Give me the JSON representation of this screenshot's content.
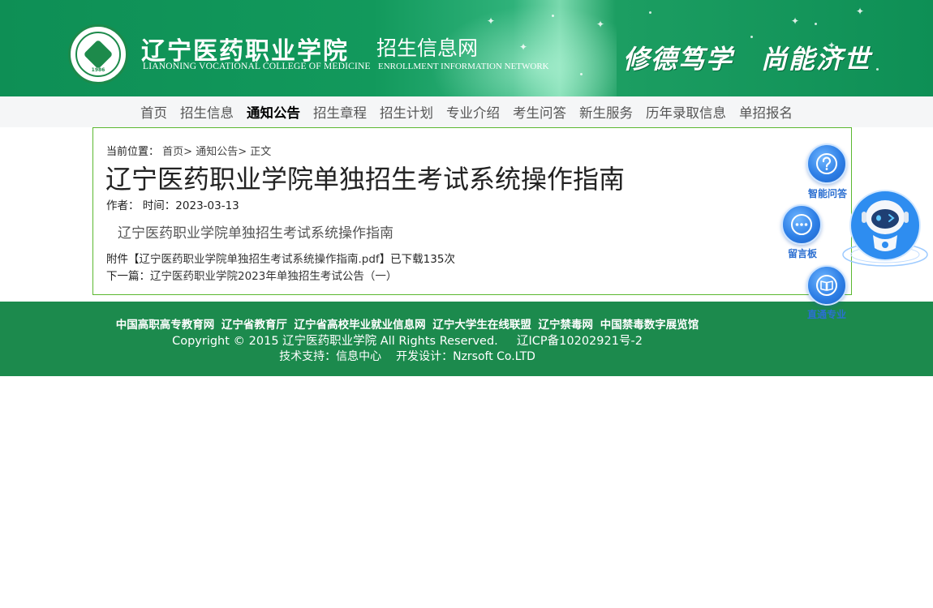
{
  "header": {
    "school_name_cn": "辽宁医药职业学院",
    "school_name_en": "LIANONING VOCATIONAL COLLEGE OF MEDICINE",
    "site_name_cn": "招生信息网",
    "site_name_en": "ENROLLMENT INFORMATION NETWORK",
    "motto": "修德笃学　尚能济世",
    "seal_year": "1986",
    "seal_icon": "college-seal-icon"
  },
  "nav": {
    "items": [
      {
        "label": "首页"
      },
      {
        "label": "招生信息"
      },
      {
        "label": "通知公告",
        "active": true
      },
      {
        "label": "招生章程"
      },
      {
        "label": "招生计划"
      },
      {
        "label": "专业介绍"
      },
      {
        "label": "考生问答"
      },
      {
        "label": "新生服务"
      },
      {
        "label": "历年录取信息"
      },
      {
        "label": "单招报名"
      }
    ]
  },
  "article": {
    "breadcrumb_label": "当前位置：",
    "breadcrumb": [
      "首页>",
      "通知公告>",
      "正文"
    ],
    "title": "辽宁医药职业学院单独招生考试系统操作指南",
    "author_label": "作者：",
    "time_label": "时间：",
    "time": "2023-03-13",
    "lead": "辽宁医药职业学院单独招生考试系统操作指南",
    "attachment_prefix": "附件【",
    "attachment_name": "辽宁医药职业学院单独招生考试系统操作指南.pdf",
    "attachment_suffix": "】已下载135次",
    "next_label": "下一篇：",
    "next_title": "辽宁医药职业学院2023年单独招生考试公告（一）"
  },
  "footer": {
    "links": [
      "中国高职高专教育网",
      "辽宁省教育厅",
      "辽宁省高校毕业就业信息网",
      "辽宁大学生在线联盟",
      "辽宁禁毒网",
      "中国禁毒数字展览馆"
    ],
    "copyright": "Copyright © 2015 辽宁医药职业学院 All Rights Reserved.",
    "icp": "辽ICP备10202921号-2",
    "tech_support": "技术支持：信息中心",
    "dev": "开发设计：Nzrsoft Co.LTD"
  },
  "widgets": {
    "qa_label": "智能问答",
    "board_label": "留言板",
    "major_label": "直通专业",
    "accent": "#2b6fd1"
  },
  "colors": {
    "brand_green": "#1c8a4d",
    "content_border": "#5bb830"
  }
}
